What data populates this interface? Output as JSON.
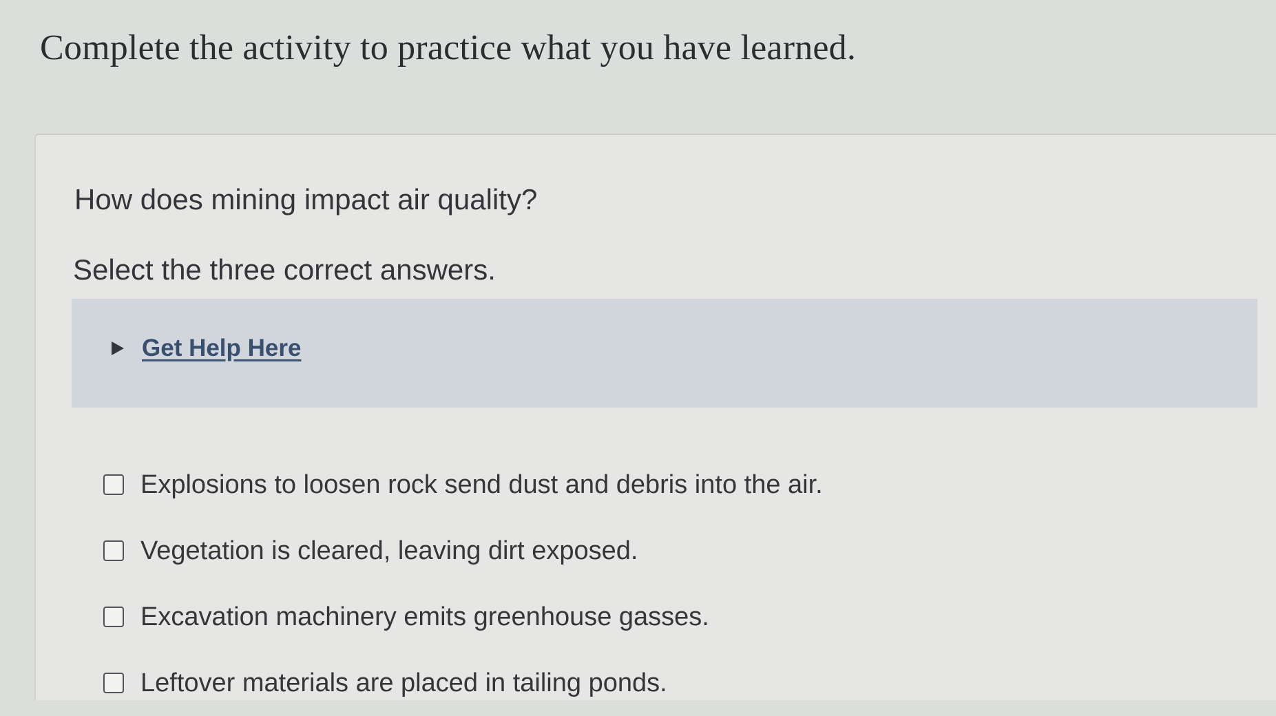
{
  "header": {
    "title": "Complete the activity to practice what you have learned."
  },
  "question": {
    "prompt": "How does mining impact air quality?",
    "instruction": "Select the three correct answers."
  },
  "help": {
    "label": "Get Help Here",
    "icon": "triangle-right-icon"
  },
  "options": [
    {
      "label": "Explosions to loosen rock send dust and debris into the air.",
      "checked": false
    },
    {
      "label": "Vegetation is cleared, leaving dirt exposed.",
      "checked": false
    },
    {
      "label": "Excavation machinery emits greenhouse gasses.",
      "checked": false
    },
    {
      "label": "Leftover materials are placed in tailing ponds.",
      "checked": false
    }
  ],
  "colors": {
    "background": "#dcdedc",
    "card": "#e6e7e5",
    "help_panel": "#d0d6dc",
    "link": "#384f6e",
    "text": "#33353a"
  }
}
